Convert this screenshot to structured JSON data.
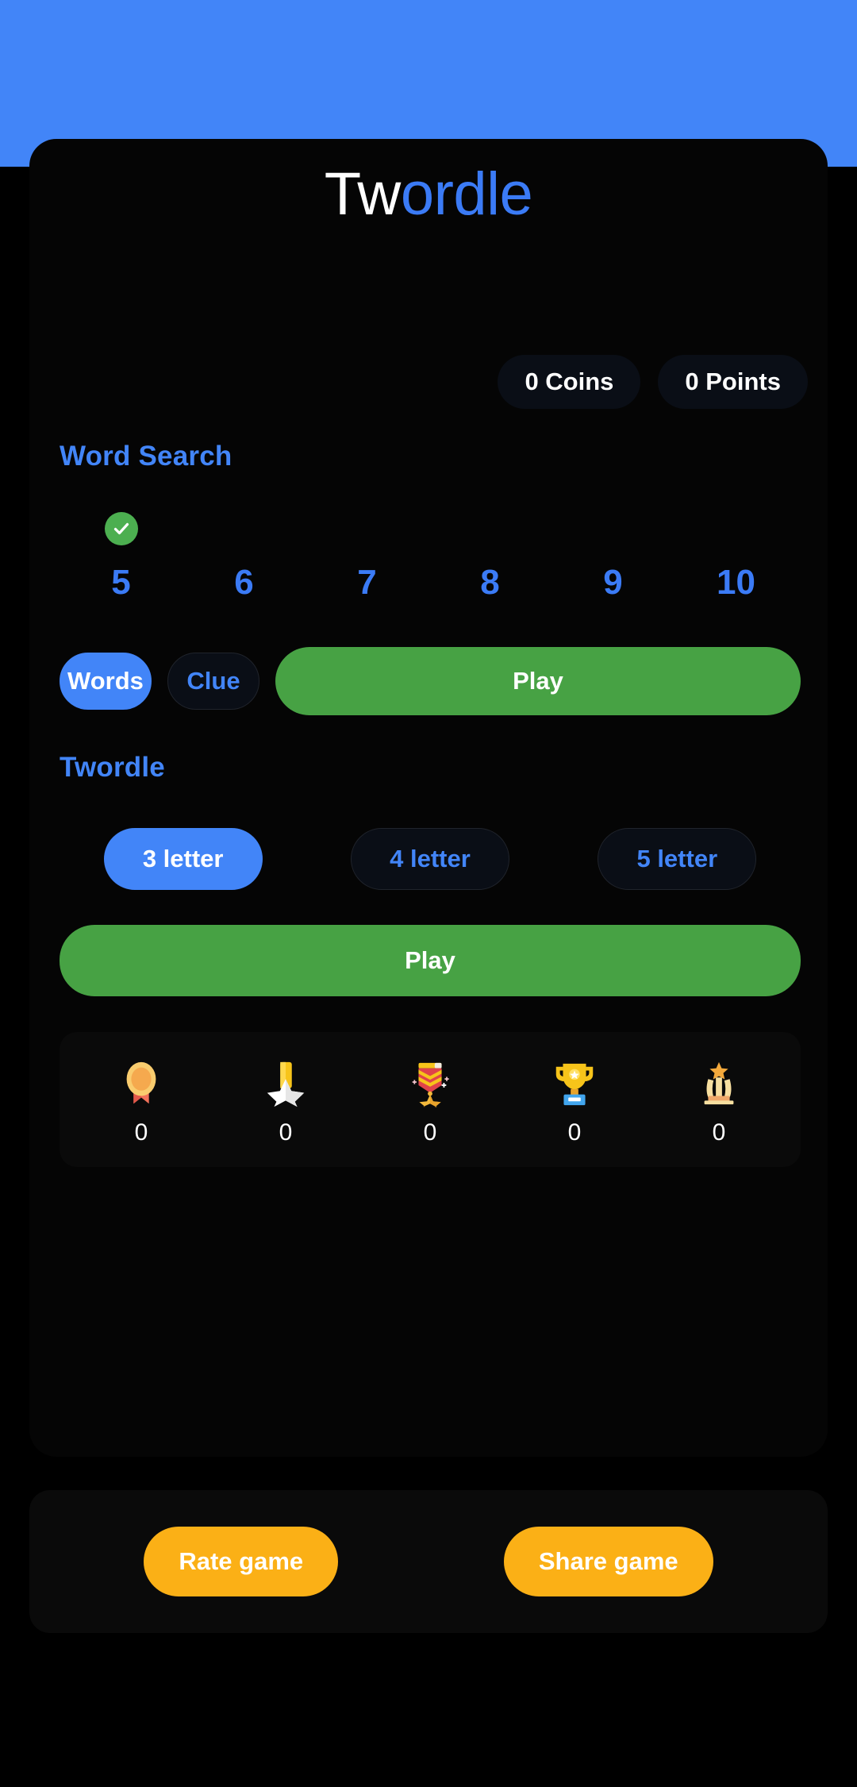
{
  "app": {
    "title_part_white": "Tw",
    "title_part_blue": "ordle",
    "accent_blue": "#4285F8",
    "accent_green": "#47A244",
    "accent_amber": "#FBB016",
    "status_bar_color": "#4285F8",
    "background": "#000000"
  },
  "stats": {
    "coins": "0 Coins",
    "points": "0 Points"
  },
  "word_search": {
    "heading": "Word Search",
    "lengths": [
      {
        "label": "5",
        "completed": true
      },
      {
        "label": "6",
        "completed": false
      },
      {
        "label": "7",
        "completed": false
      },
      {
        "label": "8",
        "completed": false
      },
      {
        "label": "9",
        "completed": false
      },
      {
        "label": "10",
        "completed": false
      }
    ],
    "mode_words": "Words",
    "mode_clue": "Clue",
    "play": "Play"
  },
  "twordle": {
    "heading": "Twordle",
    "options": [
      {
        "label": "3 letter",
        "selected": true
      },
      {
        "label": "4 letter",
        "selected": false
      },
      {
        "label": "5 letter",
        "selected": false
      }
    ],
    "play": "Play"
  },
  "achievements": [
    {
      "icon": "award-medal-icon",
      "count": "0"
    },
    {
      "icon": "star-medal-icon",
      "count": "0"
    },
    {
      "icon": "military-medal-icon",
      "count": "0"
    },
    {
      "icon": "trophy-icon",
      "count": "0"
    },
    {
      "icon": "star-monument-icon",
      "count": "0"
    }
  ],
  "footer": {
    "rate": "Rate game",
    "share": "Share game"
  }
}
